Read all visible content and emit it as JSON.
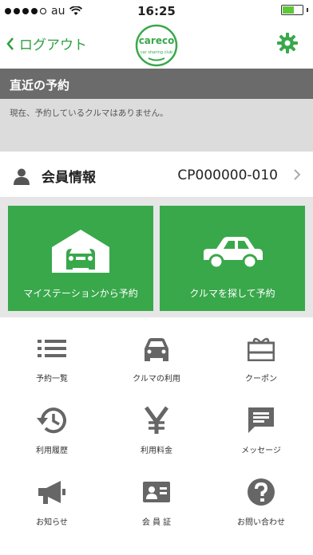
{
  "status_bar": {
    "carrier": "au",
    "time": "16:25",
    "battery_level": 0.55
  },
  "nav": {
    "back_label": "ログアウト",
    "logo_text": "careco",
    "logo_subtext": "car sharing club"
  },
  "reservations": {
    "header": "直近の予約",
    "empty_message": "現在、予約しているクルマはありません。"
  },
  "member": {
    "label": "会員情報",
    "id": "CP000000-010"
  },
  "tiles": {
    "my_station": "マイステーションから予約",
    "find_car": "クルマを探して予約"
  },
  "menu": [
    {
      "label": "予約一覧",
      "icon": "list-icon"
    },
    {
      "label": "クルマの利用",
      "icon": "car-icon"
    },
    {
      "label": "クーポン",
      "icon": "coupon-icon"
    },
    {
      "label": "利用履歴",
      "icon": "history-icon"
    },
    {
      "label": "利用料金",
      "icon": "yen-icon"
    },
    {
      "label": "メッセージ",
      "icon": "message-icon"
    },
    {
      "label": "お知らせ",
      "icon": "megaphone-icon"
    },
    {
      "label": "会 員 証",
      "icon": "member-card-icon"
    },
    {
      "label": "お問い合わせ",
      "icon": "help-icon"
    }
  ],
  "colors": {
    "accent_green": "#39a84b",
    "header_gray": "#6b6b6b",
    "icon_gray": "#666666"
  }
}
